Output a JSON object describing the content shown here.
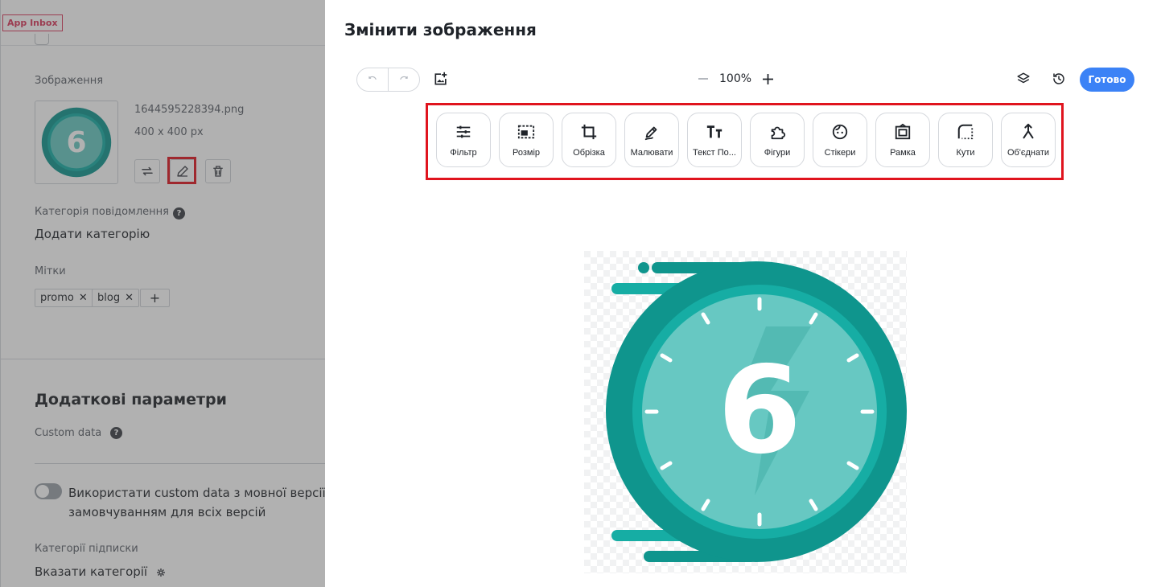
{
  "background": {
    "app_badge": "App Inbox",
    "image_section_label": "Зображення",
    "file_name": "1644595228394.png",
    "file_size": "400 x 400 px",
    "category_label": "Категорія повідомлення",
    "category_value": "Додати категорію",
    "tags_label": "Мітки",
    "tags": [
      "promo",
      "blog"
    ],
    "tag_add": "+",
    "extra_title": "Додаткові параметри",
    "custom_data_label": "Custom data",
    "toggle_text_line1": "Використати custom data з мовної версії за",
    "toggle_text_line2": "замовчуванням для всіх версій",
    "subscription_label": "Категорії підписки",
    "subscription_value": "Вказати категорії",
    "help_glyph": "?"
  },
  "modal": {
    "title": "Змінити зображення",
    "zoom_value": "100%",
    "done_label": "Готово",
    "tools": [
      {
        "label": "Фільтр",
        "icon": "sliders-icon"
      },
      {
        "label": "Розмір",
        "icon": "resize-icon"
      },
      {
        "label": "Обрізка",
        "icon": "crop-icon"
      },
      {
        "label": "Малювати",
        "icon": "draw-icon"
      },
      {
        "label": "Текст По...",
        "icon": "text-icon"
      },
      {
        "label": "Фігури",
        "icon": "shapes-icon"
      },
      {
        "label": "Стікери",
        "icon": "sticker-icon"
      },
      {
        "label": "Рамка",
        "icon": "frame-icon"
      },
      {
        "label": "Кути",
        "icon": "corners-icon"
      },
      {
        "label": "Об'єднати",
        "icon": "merge-icon"
      }
    ],
    "canvas_digit": "6"
  },
  "colors": {
    "accent_blue": "#3b82f6",
    "highlight_red": "#e0141e",
    "teal_dark": "#0f958d",
    "teal_mid": "#16ada4",
    "teal_light": "#67c8c2"
  }
}
